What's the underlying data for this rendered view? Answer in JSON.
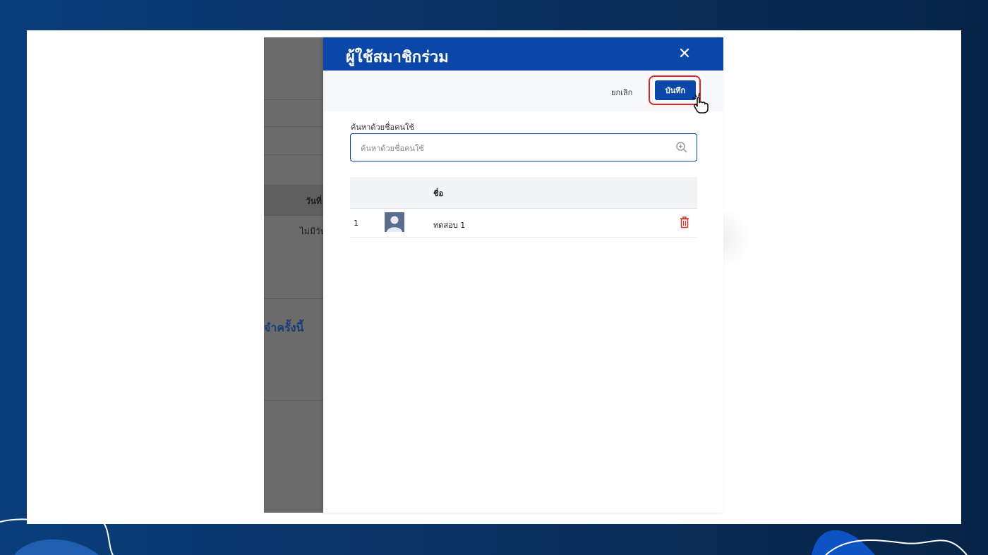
{
  "background": {
    "obscured_texts": {
      "col_header": "วันที่",
      "row_text": "ไม่มีวัน",
      "section_title": "จำครั้งนี้"
    }
  },
  "drawer": {
    "title": "ผู้ใช้สมาชิกร่วม",
    "close_icon": "close-icon",
    "toolbar": {
      "cancel_label": "ยกเลิก",
      "save_label": "บันทึก",
      "save_highlight_color": "#e0262b"
    },
    "search": {
      "label": "ค้นหาด้วยชื่อคนใช้",
      "placeholder": "ค้นหาด้วยชื่อคนใช้",
      "value": "",
      "icon": "zoom-in-search-icon"
    },
    "table": {
      "columns": [
        "",
        "",
        "ชื่อ",
        ""
      ],
      "rows": [
        {
          "index": "1",
          "avatar": "default-user-avatar",
          "name": "ทดสอบ 1",
          "action": "delete-icon"
        }
      ]
    }
  },
  "colors": {
    "primary": "#0a47a8",
    "delete": "#d9362b",
    "overlay": "#6b6b6b"
  }
}
